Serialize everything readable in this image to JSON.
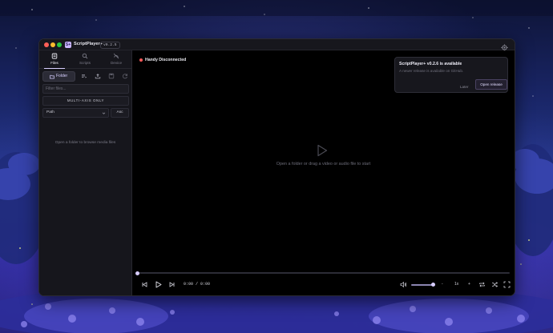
{
  "app": {
    "title": "ScriptPlayer+",
    "version": "v0.2.5",
    "icon_letter": "S+"
  },
  "sidebar": {
    "tabs": [
      {
        "label": "Files",
        "icon": "files-icon",
        "active": true
      },
      {
        "label": "Scripts",
        "icon": "search-icon",
        "active": false
      },
      {
        "label": "Device",
        "icon": "device-off-icon",
        "active": false
      }
    ],
    "folder_button_label": "Folder",
    "toolbar_icons": [
      "playlist-icon",
      "upload-icon",
      "save-icon",
      "refresh-icon"
    ],
    "filter_placeholder": "Filter files...",
    "multi_axis_label": "MULTI-AXIS ONLY",
    "sort_field": "Path",
    "sort_order": "Asc",
    "empty_hint": "Open a folder to browse media files"
  },
  "main": {
    "device_status": "Handy Disconnected",
    "status_color": "#ff5a5a",
    "drop_hint": "Open a folder or drag a video or audio file to start",
    "update_toast": {
      "title": "ScriptPlayer+ v0.2.6 is available",
      "body": "A newer release is available on GitHub.",
      "later_label": "Later",
      "open_label": "Open release"
    }
  },
  "player": {
    "time": "0:00 / 0:00",
    "progress": 0,
    "volume": 0.9,
    "speed_minus": "-",
    "speed": "1x",
    "speed_plus": "+"
  },
  "colors": {
    "accent": "#d7ccff",
    "window_bg": "#000000",
    "sidebar_bg": "#16161c"
  }
}
